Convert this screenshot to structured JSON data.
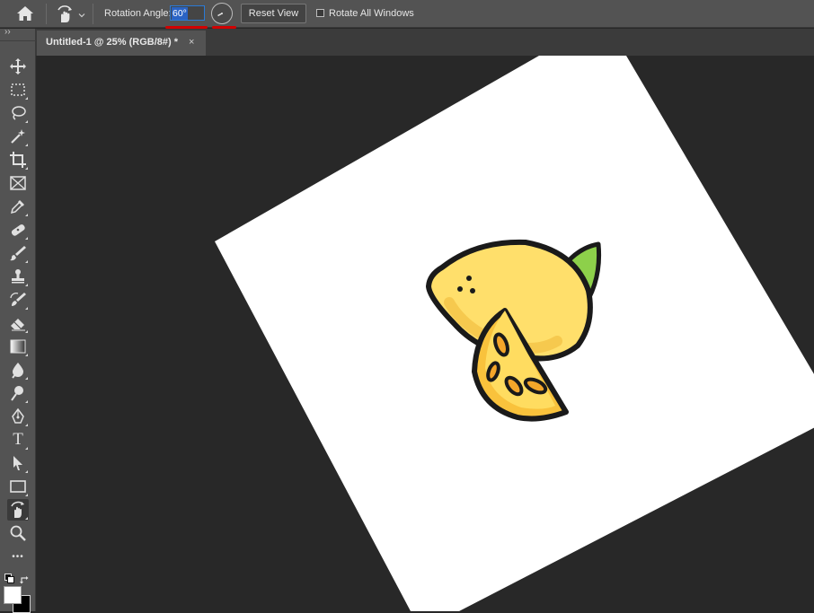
{
  "options_bar": {
    "home_icon": "home-icon",
    "tool_preset_icon": "rotate-view-icon",
    "rotation_angle_label": "Rotation Angle:",
    "rotation_angle_value": "60°",
    "reset_view_label": "Reset View",
    "rotate_all_windows_label": "Rotate All Windows",
    "rotate_all_windows_checked": false,
    "highlight_color": "#d10000"
  },
  "document_tab": {
    "title": "Untitled-1 @ 25% (RGB/8#) *",
    "close_glyph": "×"
  },
  "toolbar": {
    "expand_glyph": "››",
    "tools": [
      "move-icon",
      "rectangular-marquee-icon",
      "lasso-icon",
      "magic-wand-icon",
      "crop-icon",
      "frame-icon",
      "eyedropper-icon",
      "healing-brush-icon",
      "brush-icon",
      "clone-stamp-icon",
      "history-brush-icon",
      "eraser-icon",
      "gradient-icon",
      "blur-icon",
      "dodge-icon",
      "pen-icon",
      "type-icon",
      "path-selection-icon",
      "rectangle-icon",
      "rotate-view-icon",
      "zoom-icon",
      "more-tools-icon"
    ],
    "active_tool": "rotate-view-icon",
    "type_glyph": "T",
    "more_glyph": "•••",
    "foreground_color": "#ffffff",
    "background_color": "#000000"
  },
  "canvas": {
    "rotation_degrees": 60,
    "background": "#ffffff",
    "artwork": "lemon-illustration"
  }
}
